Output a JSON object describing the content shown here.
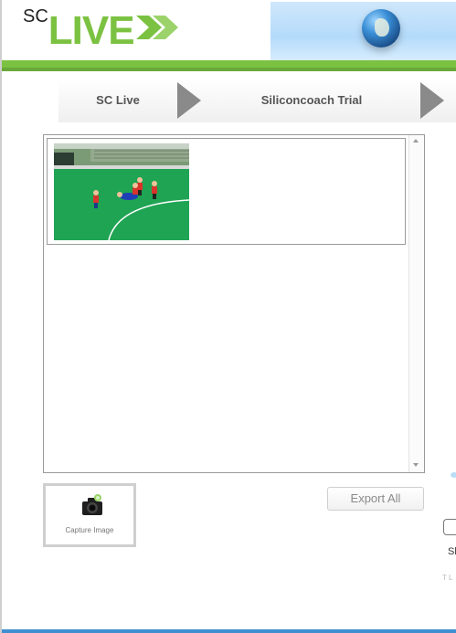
{
  "app": {
    "logo_sc": "SC",
    "logo_live": "LIVE"
  },
  "header": {
    "globe_icon": "globe-icon",
    "accent_color": "#7cc242"
  },
  "breadcrumb": {
    "items": [
      {
        "label": "SC Live"
      },
      {
        "label": "Siliconcoach Trial"
      }
    ]
  },
  "media_list": {
    "items": [
      {
        "thumbnail": "field-hockey-players-thumbnail"
      }
    ]
  },
  "actions": {
    "capture_label": "Capture Image",
    "export_label": "Export All"
  },
  "right_fragments": {
    "text_1": "Sl",
    "text_2": "T L"
  }
}
